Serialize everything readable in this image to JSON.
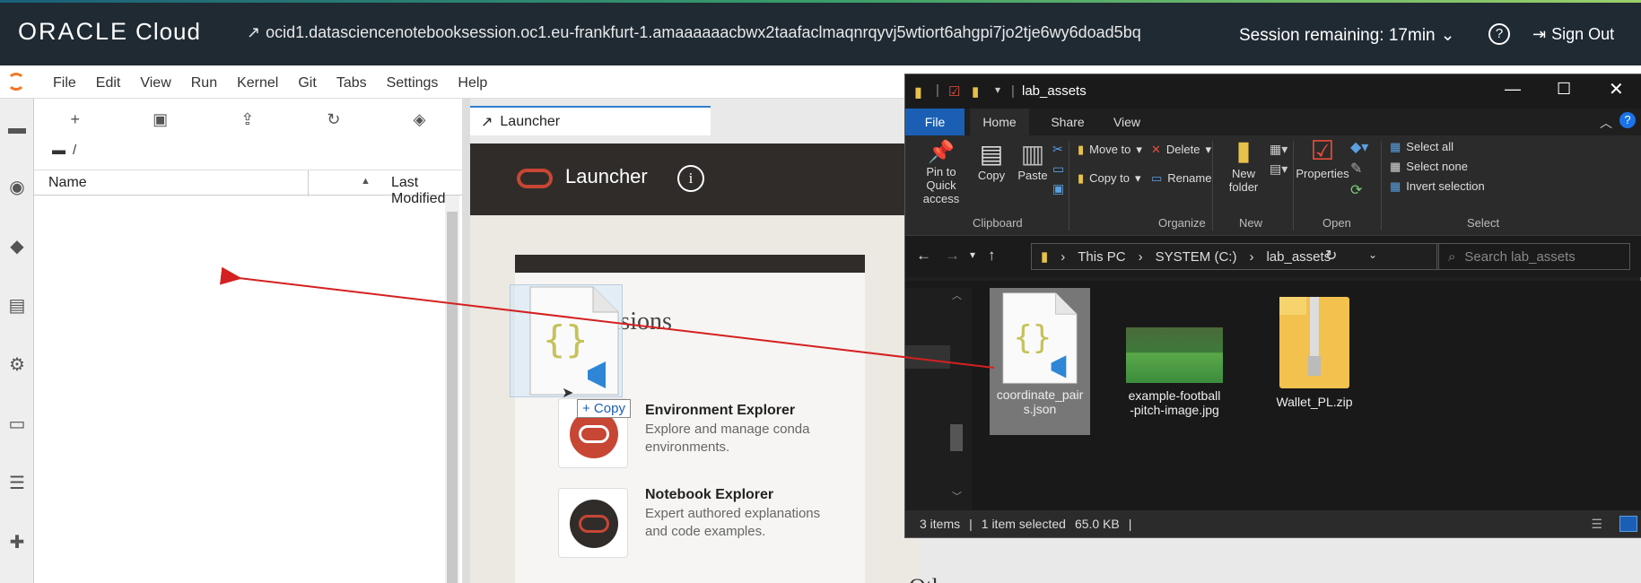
{
  "topbar": {
    "logo_brand": "ORACLE",
    "logo_product": "Cloud",
    "ocid": "ocid1.datasciencenotebooksession.oc1.eu-frankfurt-1.amaaaaaacbwx2taafaclmaqnrqyvj5wtiort6ahgpi7jo2tje6wy6doad5bq",
    "session": "Session remaining: 17min",
    "signout": "Sign Out"
  },
  "menu": [
    "File",
    "Edit",
    "View",
    "Run",
    "Kernel",
    "Git",
    "Tabs",
    "Settings",
    "Help"
  ],
  "filebrowser": {
    "path": "/",
    "col_name": "Name",
    "col_modified": "Last Modified"
  },
  "tab": {
    "label": "Launcher"
  },
  "launcher": {
    "title": "Launcher",
    "section": "Extensions",
    "items": [
      {
        "title": "Environment Explorer",
        "desc": "Explore and manage conda environments."
      },
      {
        "title": "Notebook Explorer",
        "desc": "Expert authored explanations and code examples."
      }
    ],
    "next_section": "Oth"
  },
  "drag": {
    "tooltip": "+ Copy"
  },
  "explorer": {
    "title": "lab_assets",
    "tabs": [
      "File",
      "Home",
      "Share",
      "View"
    ],
    "ribbon": {
      "pin": "Pin to Quick access",
      "copy": "Copy",
      "paste": "Paste",
      "move_to": "Move to",
      "copy_to": "Copy to",
      "delete": "Delete",
      "rename": "Rename",
      "new_folder": "New folder",
      "properties": "Properties",
      "select_all": "Select all",
      "select_none": "Select none",
      "invert": "Invert selection",
      "groups": [
        "Clipboard",
        "Organize",
        "New",
        "Open",
        "Select"
      ]
    },
    "address": [
      "This PC",
      "SYSTEM (C:)",
      "lab_assets"
    ],
    "search_placeholder": "Search lab_assets",
    "files": [
      {
        "name": "coordinate_pairs.json",
        "icon": "json-file-icon",
        "selected": true
      },
      {
        "name": "example-football-pitch-image.jpg",
        "icon": "image-thumbnail",
        "selected": false
      },
      {
        "name": "Wallet_PL.zip",
        "icon": "zip-folder-icon",
        "selected": false
      }
    ],
    "status": {
      "count": "3 items",
      "selected": "1 item selected",
      "size": "65.0 KB"
    }
  },
  "colors": {
    "accent_red": "#c74634",
    "topbar": "#1f2a33",
    "arrow": "#d42020",
    "tab_accent": "#2f7fd0"
  }
}
